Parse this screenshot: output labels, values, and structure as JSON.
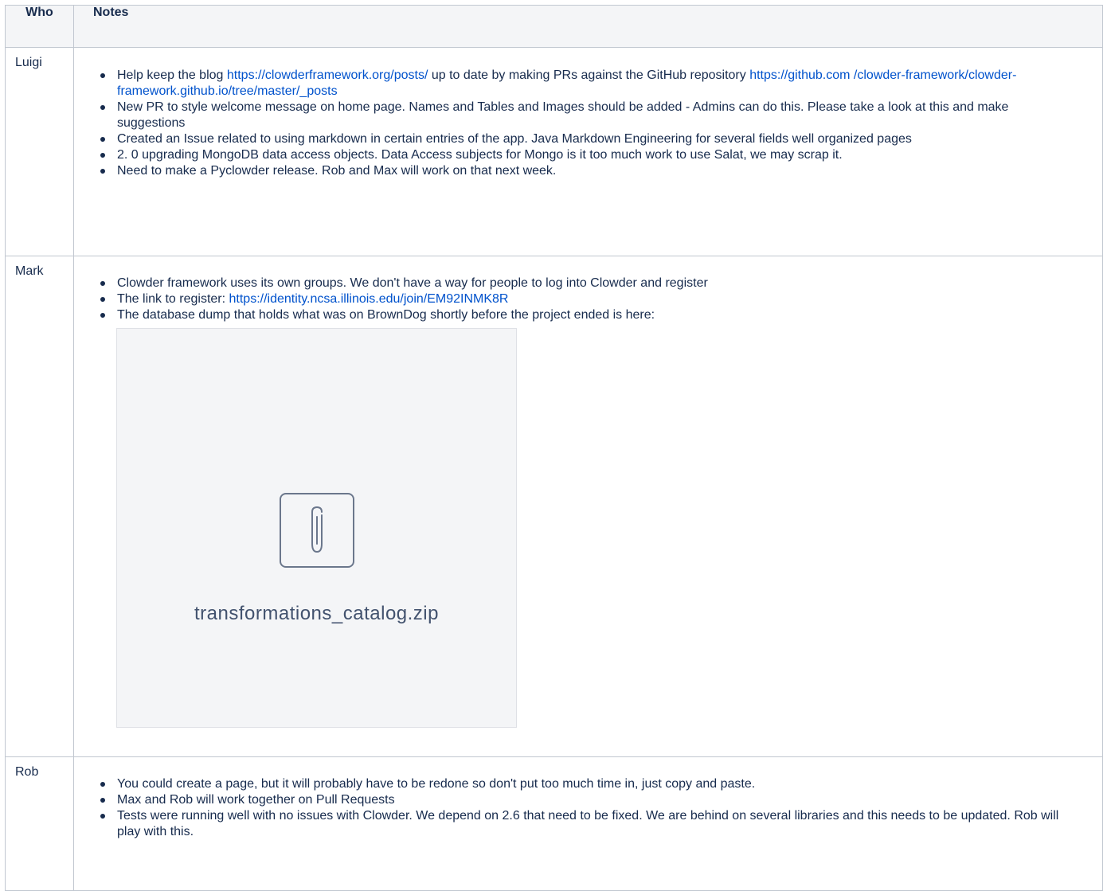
{
  "table": {
    "headers": {
      "who": "Who",
      "notes": "Notes"
    },
    "rows": [
      {
        "who": "Luigi",
        "notes": [
          {
            "parts": [
              {
                "text": "Help keep the blog "
              },
              {
                "link": "https://clowderframework.org/posts/"
              },
              {
                "text": " up to date by making PRs against the GitHub repository "
              },
              {
                "link": "https://github.com /clowder-framework/clowder-framework.github.io/tree/master/_posts"
              }
            ]
          },
          {
            "text": "New PR to style welcome message on home page. Names and Tables and Images should be added - Admins can do this.  Please take a look at this and make suggestions"
          },
          {
            "text": "Created an Issue related to using markdown in certain entries of the app. Java Markdown Engineering for several fields well organized pages"
          },
          {
            "text": "2. 0 upgrading MongoDB data access objects. Data Access subjects for Mongo is it too much work to use Salat, we may scrap it."
          },
          {
            "text": "Need to make a Pyclowder release. Rob and Max will work on that next week."
          }
        ]
      },
      {
        "who": "Mark",
        "notes": [
          {
            "text": "Clowder framework uses its own groups.  We don't have a way for people to log into Clowder and register"
          },
          {
            "parts": [
              {
                "text": "The link to register:  "
              },
              {
                "link": "https://identity.ncsa.illinois.edu/join/EM92INMK8R"
              }
            ]
          },
          {
            "text": "The database dump that holds what was on BrownDog shortly before the project ended is here:"
          }
        ],
        "attachment": {
          "icon": "paperclip-icon",
          "filename": "transformations_catalog.zip"
        }
      },
      {
        "who": "Rob",
        "notes": [
          {
            "text": "You could create a page, but it will probably have to be redone so don't put too much time in, just copy and paste."
          },
          {
            "text": "Max and Rob will work together on Pull Requests"
          },
          {
            "text": "Tests were running well with no issues with Clowder.  We depend on 2.6 that need to be fixed.  We are behind on several libraries and this needs to be updated.  Rob will play with this."
          }
        ]
      }
    ]
  }
}
